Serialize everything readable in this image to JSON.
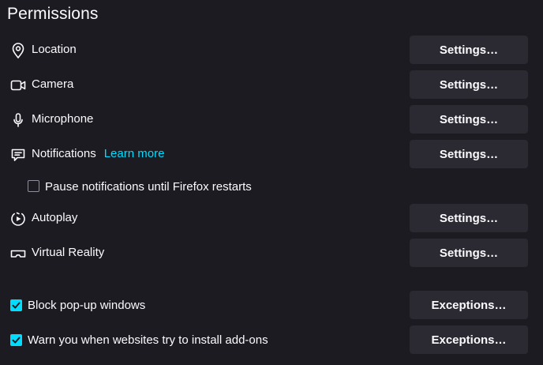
{
  "section": {
    "title": "Permissions"
  },
  "rows": [
    {
      "label": "Location",
      "icon": "location-pin-icon",
      "button": "Settings…"
    },
    {
      "label": "Camera",
      "icon": "camera-icon",
      "button": "Settings…"
    },
    {
      "label": "Microphone",
      "icon": "microphone-icon",
      "button": "Settings…"
    },
    {
      "label": "Notifications",
      "icon": "notification-icon",
      "button": "Settings…",
      "link": "Learn more"
    },
    {
      "label": "Autoplay",
      "icon": "autoplay-icon",
      "button": "Settings…"
    },
    {
      "label": "Virtual Reality",
      "icon": "vr-headset-icon",
      "button": "Settings…"
    }
  ],
  "pause_notifications": {
    "label": "Pause notifications until Firefox restarts",
    "checked": false
  },
  "checkboxes": [
    {
      "label": "Block pop-up windows",
      "checked": true,
      "button": "Exceptions…"
    },
    {
      "label": "Warn you when websites try to install add-ons",
      "checked": true,
      "button": "Exceptions…"
    }
  ],
  "colors": {
    "background": "#1c1b22",
    "button": "#2b2a33",
    "accent": "#00ddff",
    "text": "#fbfbfe"
  }
}
